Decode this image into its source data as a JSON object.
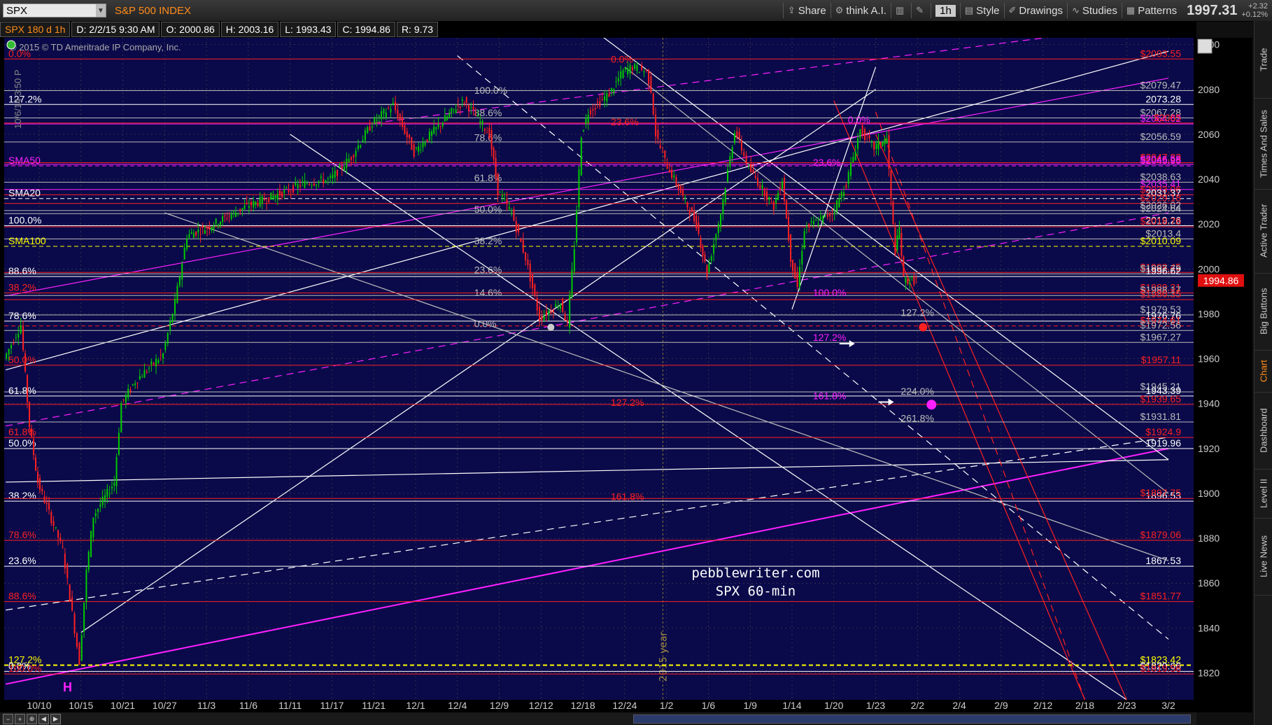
{
  "app": {
    "symbol": "SPX",
    "index_name": "S&P 500 INDEX",
    "toolbar": [
      {
        "icon": "share-icon",
        "label": "Share"
      },
      {
        "icon": "think-icon",
        "label": "think A.I."
      },
      {
        "icon": "chart-type-icon",
        "label": ""
      },
      {
        "icon": "wrench-icon",
        "label": ""
      },
      {
        "icon": "",
        "label": "1h"
      },
      {
        "icon": "style-icon",
        "label": "Style"
      },
      {
        "icon": "pencil-icon",
        "label": "Drawings"
      },
      {
        "icon": "studies-icon",
        "label": "Studies"
      },
      {
        "icon": "patterns-icon",
        "label": "Patterns"
      }
    ],
    "last_price": "1997.31",
    "change_top": "+2.32",
    "change_bottom": "+0.12%",
    "info": {
      "symbol": "SPX 180 d 1h",
      "date": "D: 2/2/15 9:30 AM",
      "open": "O: 2000.86",
      "high": "H: 2003.16",
      "low": "L: 1993.43",
      "close": "C: 1994.86",
      "range": "R: 9.73"
    },
    "side_tabs": [
      {
        "label": "Trade",
        "active": false
      },
      {
        "label": "Times And Sales",
        "active": false
      },
      {
        "label": "Active Trader",
        "active": false
      },
      {
        "label": "Big Buttons",
        "active": false
      },
      {
        "label": "Chart",
        "active": true
      },
      {
        "label": "Dashboard",
        "active": false
      },
      {
        "label": "Level II",
        "active": false
      },
      {
        "label": "Live News",
        "active": false
      }
    ],
    "colors": {
      "background": "#0a0a4a",
      "candle_up": "#00cc00",
      "candle_down": "#ff2020",
      "fib_red": "#ff2020",
      "magenta": "#ff20ff",
      "white": "#ffffff",
      "yellow": "#ffff00",
      "grid": "#555555"
    }
  },
  "chart_data": {
    "type": "candlestick",
    "title": "SPX 60-min",
    "watermark": "pebblewriter.com",
    "copyright": "© 2015 © TD Ameritrade IP Company, Inc.",
    "time_label": "10/6/14 3:50 P",
    "year_label": "2015 year",
    "pattern_label": "H",
    "ylim": [
      1808,
      2103
    ],
    "y_ticks": [
      2100,
      2080,
      2060,
      2040,
      2020,
      2000,
      1980,
      1960,
      1940,
      1920,
      1900,
      1880,
      1860,
      1840,
      1820
    ],
    "x_ticks": [
      "10/10",
      "10/15",
      "10/21",
      "10/27",
      "11/3",
      "11/6",
      "11/11",
      "11/17",
      "11/21",
      "12/1",
      "12/4",
      "12/9",
      "12/12",
      "12/18",
      "12/24",
      "1/2",
      "1/6",
      "1/9",
      "1/14",
      "1/20",
      "1/23",
      "2/2",
      "2/4",
      "2/9",
      "2/12",
      "2/18",
      "2/23",
      "3/2"
    ],
    "current_price": "1994.86",
    "price_path": [
      {
        "d": "10/6",
        "v": 1960
      },
      {
        "d": "10/8",
        "v": 1975
      },
      {
        "d": "10/9",
        "v": 1930
      },
      {
        "d": "10/10",
        "v": 1905
      },
      {
        "d": "10/13",
        "v": 1875
      },
      {
        "d": "10/15",
        "v": 1825
      },
      {
        "d": "10/16",
        "v": 1865
      },
      {
        "d": "10/17",
        "v": 1890
      },
      {
        "d": "10/20",
        "v": 1905
      },
      {
        "d": "10/21",
        "v": 1940
      },
      {
        "d": "10/23",
        "v": 1950
      },
      {
        "d": "10/27",
        "v": 1962
      },
      {
        "d": "10/29",
        "v": 1985
      },
      {
        "d": "10/31",
        "v": 2015
      },
      {
        "d": "11/3",
        "v": 2018
      },
      {
        "d": "11/6",
        "v": 2028
      },
      {
        "d": "11/11",
        "v": 2035
      },
      {
        "d": "11/13",
        "v": 2038
      },
      {
        "d": "11/17",
        "v": 2040
      },
      {
        "d": "11/19",
        "v": 2050
      },
      {
        "d": "11/21",
        "v": 2065
      },
      {
        "d": "11/26",
        "v": 2073
      },
      {
        "d": "12/1",
        "v": 2052
      },
      {
        "d": "12/4",
        "v": 2072
      },
      {
        "d": "12/5",
        "v": 2075
      },
      {
        "d": "12/8",
        "v": 2060
      },
      {
        "d": "12/9",
        "v": 2035
      },
      {
        "d": "12/10",
        "v": 2025
      },
      {
        "d": "12/11",
        "v": 2005
      },
      {
        "d": "12/12",
        "v": 1978
      },
      {
        "d": "12/15",
        "v": 1985
      },
      {
        "d": "12/16",
        "v": 1975
      },
      {
        "d": "12/17",
        "v": 2010
      },
      {
        "d": "12/18",
        "v": 2060
      },
      {
        "d": "12/19",
        "v": 2070
      },
      {
        "d": "12/22",
        "v": 2078
      },
      {
        "d": "12/24",
        "v": 2088
      },
      {
        "d": "12/26",
        "v": 2090
      },
      {
        "d": "12/29",
        "v": 2088
      },
      {
        "d": "12/30",
        "v": 2080
      },
      {
        "d": "12/31",
        "v": 2060
      },
      {
        "d": "1/2",
        "v": 2048
      },
      {
        "d": "1/5",
        "v": 2020
      },
      {
        "d": "1/6",
        "v": 1998
      },
      {
        "d": "1/7",
        "v": 2025
      },
      {
        "d": "1/8",
        "v": 2062
      },
      {
        "d": "1/9",
        "v": 2045
      },
      {
        "d": "1/12",
        "v": 2028
      },
      {
        "d": "1/13",
        "v": 2040
      },
      {
        "d": "1/14",
        "v": 2005
      },
      {
        "d": "1/15",
        "v": 1992
      },
      {
        "d": "1/16",
        "v": 2018
      },
      {
        "d": "1/20",
        "v": 2025
      },
      {
        "d": "1/21",
        "v": 2038
      },
      {
        "d": "1/22",
        "v": 2062
      },
      {
        "d": "1/23",
        "v": 2054
      },
      {
        "d": "1/26",
        "v": 2058
      },
      {
        "d": "1/27",
        "v": 2030
      },
      {
        "d": "1/28",
        "v": 2008
      },
      {
        "d": "1/29",
        "v": 2018
      },
      {
        "d": "1/30",
        "v": 1995
      },
      {
        "d": "2/2",
        "v": 1994.86
      }
    ],
    "horizontal_levels": [
      {
        "value": 2093.55,
        "label_left": "0.0%",
        "label_right": "$2093.55",
        "color": "#ff2020"
      },
      {
        "value": 2079.47,
        "label_right": "$2079.47",
        "color": "#bbbbbb"
      },
      {
        "value": 2073.28,
        "label_left": "127.2%",
        "label_right": "2073.28",
        "color": "#ffffff"
      },
      {
        "value": 2067.28,
        "label_right": "$2067.28",
        "color": "#bbbbbb"
      },
      {
        "value": 2064.62,
        "label_right": "$2064.62",
        "color": "#ff20ff"
      },
      {
        "value": 2065,
        "label_right": "$2065",
        "color": "#ff2020"
      },
      {
        "value": 2056.59,
        "label_right": "$2056.59",
        "color": "#bbbbbb"
      },
      {
        "value": 2046.58,
        "label_right": "$2046.58",
        "color": "#ff20ff"
      },
      {
        "value": 2047.33,
        "label_right": "$2047.33",
        "color": "#ff2020"
      },
      {
        "value": 2045.95,
        "label_left": "SMA50",
        "label_right": "$2045.95",
        "color": "#ff20ff",
        "dashed": true
      },
      {
        "value": 2038.63,
        "label_right": "$2038.63",
        "color": "#bbbbbb"
      },
      {
        "value": 2035.41,
        "label_right": "$2035.41",
        "color": "#ff20ff"
      },
      {
        "value": 2033.06,
        "label_right": "$2033.06",
        "color": "#ff2020"
      },
      {
        "value": 2031.37,
        "label_left": "SMA20",
        "label_right": "2031.37",
        "color": "#ffffff",
        "dashed": true
      },
      {
        "value": 2029.18,
        "label_right": "$2029.18",
        "color": "#ff2020"
      },
      {
        "value": 2026.02,
        "label_right": "$2026.02",
        "color": "#bbbbbb"
      },
      {
        "value": 2024.64,
        "label_right": "$2024.64",
        "color": "#bbbbbb"
      },
      {
        "value": 2019.26,
        "label_left": "100.0%",
        "label_right": "2019.26",
        "color": "#ffffff"
      },
      {
        "value": 2018.78,
        "label_right": "$2018.78",
        "color": "#ff2020"
      },
      {
        "value": 2013.4,
        "label_right": "$2013.4",
        "color": "#bbbbbb"
      },
      {
        "value": 2010.09,
        "label_left": "SMA100",
        "label_right": "$2010.09",
        "color": "#ffff00",
        "dashed": true
      },
      {
        "value": 1998.45,
        "label_right": "$1998.45",
        "color": "#ff2020"
      },
      {
        "value": 1997.79,
        "label_right": "$1997.79",
        "color": "#bbbbbb"
      },
      {
        "value": 1996.62,
        "label_left": "88.6%",
        "label_right": "1996.62",
        "color": "#ffffff"
      },
      {
        "value": 1989.31,
        "label_left": "38.2%",
        "label_right": "$1989.31",
        "color": "#ff2020"
      },
      {
        "value": 1988.17,
        "label_right": "$1988.17",
        "color": "#bbbbbb"
      },
      {
        "value": 1986.35,
        "label_right": "$1986.35",
        "color": "#ff2020"
      },
      {
        "value": 1979.53,
        "label_right": "$1979.53",
        "color": "#bbbbbb"
      },
      {
        "value": 1976.76,
        "label_left": "78.6%",
        "label_right": "1976.76",
        "color": "#ffffff"
      },
      {
        "value": 1974.61,
        "label_right": "$1974.61",
        "color": "#ff2020",
        "dashed": true
      },
      {
        "value": 1972.56,
        "label_right": "$1972.56",
        "color": "#bbbbbb"
      },
      {
        "value": 1967.27,
        "label_right": "$1967.27",
        "color": "#bbbbbb"
      },
      {
        "value": 1957.11,
        "label_left": "50.0%",
        "label_right": "$1957.11",
        "color": "#ff2020"
      },
      {
        "value": 1945.21,
        "label_right": "$1945.21",
        "color": "#bbbbbb"
      },
      {
        "value": 1943.39,
        "label_left": "61.8%",
        "label_right": "1943.39",
        "color": "#ffffff"
      },
      {
        "value": 1939.65,
        "label_right": "$1939.65",
        "color": "#ff2020"
      },
      {
        "value": 1931.81,
        "label_right": "$1931.81",
        "color": "#bbbbbb"
      },
      {
        "value": 1924.9,
        "label_left": "61.8%",
        "label_right": "$1924.9",
        "color": "#ff2020"
      },
      {
        "value": 1919.96,
        "label_left": "50.0%",
        "label_right": "1919.96",
        "color": "#ffffff"
      },
      {
        "value": 1896.53,
        "label_left": "38.2%",
        "label_right": "1896.53",
        "color": "#ffffff"
      },
      {
        "value": 1897.75,
        "label_right": "$1897.75",
        "color": "#ff2020"
      },
      {
        "value": 1879.06,
        "label_left": "78.6%",
        "label_right": "$1879.06",
        "color": "#ff2020"
      },
      {
        "value": 1867.53,
        "label_left": "23.6%",
        "label_right": "1867.53",
        "color": "#ffffff"
      },
      {
        "value": 1851.77,
        "label_left": "88.6%",
        "label_right": "$1851.77",
        "color": "#ff2020"
      },
      {
        "value": 1823.42,
        "label_left": "127.2%",
        "label_right": "$1823.42",
        "color": "#ffff00",
        "dashed": true
      },
      {
        "value": 1820.66,
        "label_left": "0.0%",
        "label_right": "$1820.66",
        "color": "#ffffff"
      },
      {
        "value": 1819.5,
        "label_left": "100.0%",
        "label_right": "$1819.56",
        "color": "#ff2020"
      }
    ],
    "mid_fib_labels": [
      {
        "d": "12/6",
        "v": 2078,
        "label": "100.0%",
        "color": "#bbbbbb"
      },
      {
        "d": "12/6",
        "v": 2068,
        "label": "88.6%",
        "color": "#bbbbbb"
      },
      {
        "d": "12/6",
        "v": 2057,
        "label": "78.6%",
        "color": "#bbbbbb"
      },
      {
        "d": "12/6",
        "v": 2039,
        "label": "61.8%",
        "color": "#bbbbbb"
      },
      {
        "d": "12/6",
        "v": 2025,
        "label": "50.0%",
        "color": "#bbbbbb"
      },
      {
        "d": "12/6",
        "v": 2011,
        "label": "38.2%",
        "color": "#bbbbbb"
      },
      {
        "d": "12/6",
        "v": 1998,
        "label": "23.6%",
        "color": "#bbbbbb"
      },
      {
        "d": "12/6",
        "v": 1988,
        "label": "14.6%",
        "color": "#bbbbbb"
      },
      {
        "d": "12/6",
        "v": 1974,
        "label": "0.0%",
        "color": "#bbbbbb"
      },
      {
        "d": "12/22",
        "v": 2092,
        "label": "0.0%",
        "color": "#ff2020"
      },
      {
        "d": "12/22",
        "v": 2064,
        "label": "23.6%",
        "color": "#ff2020"
      },
      {
        "d": "12/22",
        "v": 1939,
        "label": "127.2%",
        "color": "#ff2020"
      },
      {
        "d": "12/22",
        "v": 1897,
        "label": "161.8%",
        "color": "#ff2020"
      },
      {
        "d": "1/21",
        "v": 2065,
        "label": "0.0%",
        "color": "#ff20ff"
      },
      {
        "d": "1/17",
        "v": 2046,
        "label": "23.6%",
        "color": "#ff20ff"
      },
      {
        "d": "1/17",
        "v": 1988,
        "label": "100.0%",
        "color": "#ff20ff"
      },
      {
        "d": "1/17",
        "v": 1968,
        "label": "127.2%",
        "color": "#ff20ff"
      },
      {
        "d": "1/17",
        "v": 1942,
        "label": "161.8%",
        "color": "#ff20ff"
      },
      {
        "d": "1/29",
        "v": 1944,
        "label": "224.0%",
        "color": "#bbbbbb"
      },
      {
        "d": "1/29",
        "v": 1932,
        "label": "261.8%",
        "color": "#bbbbbb"
      },
      {
        "d": "1/29",
        "v": 1979,
        "label": "127.2%",
        "color": "#bbbbbb"
      }
    ],
    "trend_lines": [
      {
        "from": [
          "10/6",
          1955
        ],
        "to": [
          "3/2",
          2097
        ],
        "color": "#ffffff"
      },
      {
        "from": [
          "10/6",
          1988
        ],
        "to": [
          "3/2",
          2085
        ],
        "color": "#ff20ff"
      },
      {
        "from": [
          "10/6",
          1815
        ],
        "to": [
          "3/2",
          1920
        ],
        "color": "#ff20ff",
        "width": 2
      },
      {
        "from": [
          "10/6",
          1848
        ],
        "to": [
          "3/2",
          1925
        ],
        "color": "#ffffff",
        "dashed": true
      },
      {
        "from": [
          "10/6",
          1905
        ],
        "to": [
          "3/2",
          1915
        ],
        "color": "#ffffff"
      },
      {
        "from": [
          "10/6",
          1930
        ],
        "to": [
          "3/2",
          2025
        ],
        "color": "#ff20ff",
        "dashed": true
      },
      {
        "from": [
          "11/21",
          2065
        ],
        "to": [
          "3/2",
          2110
        ],
        "color": "#ff20ff",
        "dashed": true
      },
      {
        "from": [
          "10/15",
          1838
        ],
        "to": [
          "1/23",
          2080
        ],
        "color": "#ffffff"
      },
      {
        "from": [
          "12/4",
          2095
        ],
        "to": [
          "3/2",
          1835
        ],
        "color": "#ffffff",
        "dashed": true
      },
      {
        "from": [
          "12/18",
          2110
        ],
        "to": [
          "3/2",
          1915
        ],
        "color": "#ffffff"
      },
      {
        "from": [
          "12/24",
          2090
        ],
        "to": [
          "3/2",
          1900
        ],
        "color": "#bbbbbb"
      },
      {
        "from": [
          "11/11",
          2060
        ],
        "to": [
          "2/23",
          1808
        ],
        "color": "#ffffff"
      },
      {
        "from": [
          "10/27",
          2025
        ],
        "to": [
          "3/2",
          1870
        ],
        "color": "#bbbbbb"
      },
      {
        "from": [
          "1/20",
          2075
        ],
        "to": [
          "2/18",
          1808
        ],
        "color": "#ff2020"
      },
      {
        "from": [
          "1/23",
          2070
        ],
        "to": [
          "2/18",
          1808
        ],
        "color": "#ff2020",
        "dashed": true
      },
      {
        "from": [
          "1/23",
          2060
        ],
        "to": [
          "2/23",
          1808
        ],
        "color": "#ff2020"
      },
      {
        "from": [
          "1/14",
          1982
        ],
        "to": [
          "1/23",
          2090
        ],
        "color": "#ffffff"
      }
    ]
  }
}
